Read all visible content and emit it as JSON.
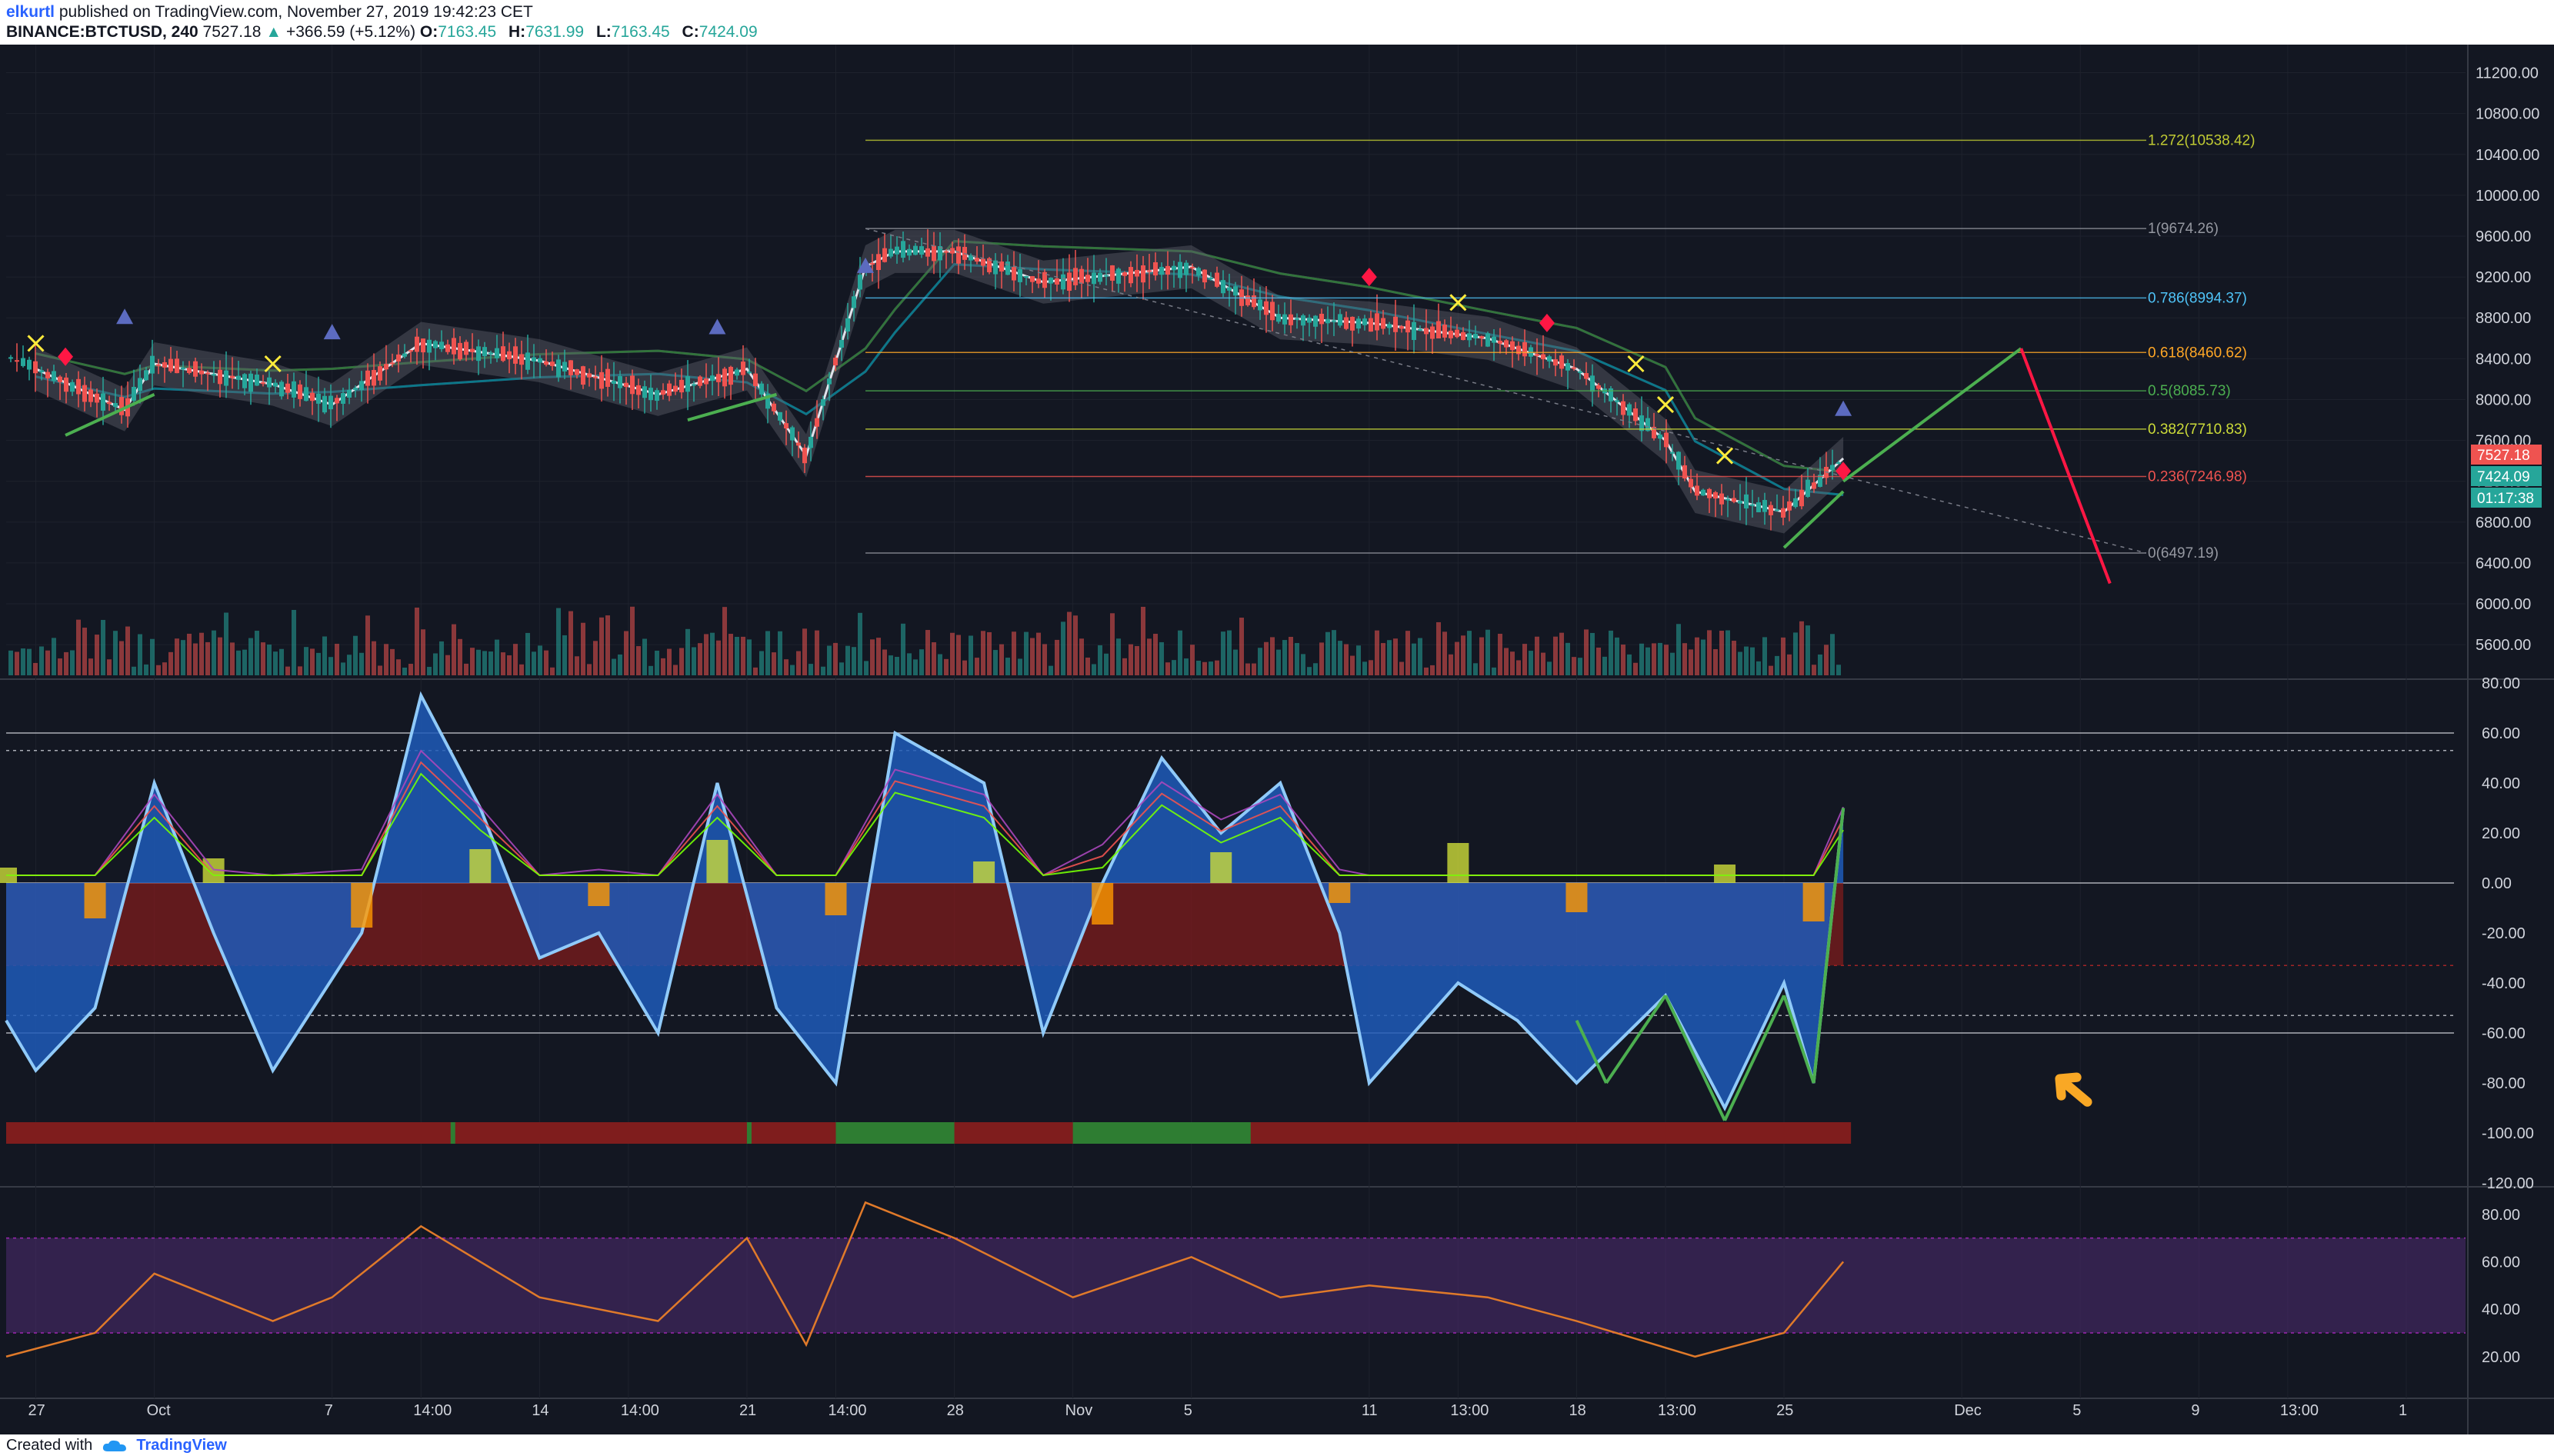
{
  "header": {
    "author": "elkurtl",
    "published_text": "published on TradingView.com, November 27, 2019 19:42:23 CET",
    "symbol": "BINANCE:BTCTUSD, 240",
    "last": "7527.18",
    "change": "+366.59 (+5.12%)",
    "o_label": "O:",
    "o_value": "7163.45",
    "h_label": "H:",
    "h_value": "7631.99",
    "l_label": "L:",
    "l_value": "7163.45",
    "c_label": "C:",
    "c_value": "7424.09"
  },
  "footer": {
    "created_with": "Created with",
    "brand": "TradingView"
  },
  "price_badges": {
    "last_price": "7527.18",
    "close_price": "7424.09",
    "countdown": "01:17:38"
  },
  "annotations": {
    "arrow": "➜"
  },
  "chart_data": [
    {
      "type": "candlestick",
      "panel": "price",
      "y_ticks": [
        "11200.00",
        "10800.00",
        "10400.00",
        "10000.00",
        "9600.00",
        "9200.00",
        "8800.00",
        "8400.00",
        "8000.00",
        "7600.00",
        "7200.00",
        "6800.00",
        "6400.00",
        "6000.00",
        "5600.00"
      ],
      "x_ticks": [
        "27",
        "Oct",
        "7",
        "14:00",
        "14",
        "14:00",
        "21",
        "14:00",
        "28",
        "Nov",
        "5",
        "11",
        "13:00",
        "18",
        "13:00",
        "25",
        "Dec",
        "5",
        "9",
        "13:00",
        "1"
      ],
      "ylim": [
        5300,
        11400
      ],
      "approx_close_path": [
        {
          "x": "Sep 27",
          "y": 8300
        },
        {
          "x": "Sep 30",
          "y": 7900
        },
        {
          "x": "Oct 1",
          "y": 8350
        },
        {
          "x": "Oct 5",
          "y": 8150
        },
        {
          "x": "Oct 7",
          "y": 7950
        },
        {
          "x": "Oct 10",
          "y": 8550
        },
        {
          "x": "Oct 14",
          "y": 8380
        },
        {
          "x": "Oct 18",
          "y": 8050
        },
        {
          "x": "Oct 21",
          "y": 8300
        },
        {
          "x": "Oct 23",
          "y": 7450
        },
        {
          "x": "Oct 25",
          "y": 9300
        },
        {
          "x": "Oct 26",
          "y": 9450
        },
        {
          "x": "Oct 28",
          "y": 9450
        },
        {
          "x": "Oct 31",
          "y": 9150
        },
        {
          "x": "Nov 5",
          "y": 9300
        },
        {
          "x": "Nov 8",
          "y": 8800
        },
        {
          "x": "Nov 11",
          "y": 8750
        },
        {
          "x": "Nov 15",
          "y": 8600
        },
        {
          "x": "Nov 18",
          "y": 8300
        },
        {
          "x": "Nov 21",
          "y": 7600
        },
        {
          "x": "Nov 22",
          "y": 7100
        },
        {
          "x": "Nov 25",
          "y": 6900
        },
        {
          "x": "Nov 27",
          "y": 7424
        }
      ],
      "fibonacci": [
        {
          "label": "1.272(10538.42)",
          "value": 10538.42,
          "color": "#c0ca33"
        },
        {
          "label": "1(9674.26)",
          "value": 9674.26,
          "color": "#9598a1"
        },
        {
          "label": "0.786(8994.37)",
          "value": 8994.37,
          "color": "#4fc3f7"
        },
        {
          "label": "0.618(8460.62)",
          "value": 8460.62,
          "color": "#ffa726"
        },
        {
          "label": "0.5(8085.73)",
          "value": 8085.73,
          "color": "#4caf50"
        },
        {
          "label": "0.382(7710.83)",
          "value": 7710.83,
          "color": "#cddc39"
        },
        {
          "label": "0.236(7246.98)",
          "value": 7246.98,
          "color": "#ef5350"
        },
        {
          "label": "0(6497.19)",
          "value": 6497.19,
          "color": "#9598a1"
        }
      ],
      "projections": [
        {
          "name": "green-projection",
          "color": "#4caf50",
          "from": {
            "x": "Nov 27",
            "y": 7200
          },
          "to": {
            "x": "Dec 3",
            "y": 8500
          }
        },
        {
          "name": "red-projection",
          "color": "#ff1744",
          "from": {
            "x": "Dec 3",
            "y": 8500
          },
          "to": {
            "x": "Dec 6",
            "y": 6200
          }
        }
      ]
    },
    {
      "type": "area",
      "panel": "wavetrend-oscillator",
      "y_ticks": [
        "80.00",
        "60.00",
        "40.00",
        "20.00",
        "0.00",
        "-20.00",
        "-40.00",
        "-60.00",
        "-80.00",
        "-100.00",
        "-120.00"
      ],
      "ylim": [
        -120,
        80
      ],
      "levels": [
        60,
        53,
        0,
        -33,
        -53,
        -60
      ],
      "approx_path": [
        {
          "x": "Sep 26",
          "y": -55
        },
        {
          "x": "Sep 27",
          "y": -75
        },
        {
          "x": "Sep 29",
          "y": -50
        },
        {
          "x": "Oct 1",
          "y": 40
        },
        {
          "x": "Oct 3",
          "y": -20
        },
        {
          "x": "Oct 5",
          "y": -75
        },
        {
          "x": "Oct 8",
          "y": -20
        },
        {
          "x": "Oct 10",
          "y": 75
        },
        {
          "x": "Oct 12",
          "y": 30
        },
        {
          "x": "Oct 14",
          "y": -30
        },
        {
          "x": "Oct 16",
          "y": -20
        },
        {
          "x": "Oct 18",
          "y": -60
        },
        {
          "x": "Oct 20",
          "y": 40
        },
        {
          "x": "Oct 22",
          "y": -50
        },
        {
          "x": "Oct 24",
          "y": -80
        },
        {
          "x": "Oct 26",
          "y": 60
        },
        {
          "x": "Oct 29",
          "y": 40
        },
        {
          "x": "Oct 31",
          "y": -60
        },
        {
          "x": "Nov 2",
          "y": 0
        },
        {
          "x": "Nov 4",
          "y": 50
        },
        {
          "x": "Nov 6",
          "y": 20
        },
        {
          "x": "Nov 8",
          "y": 40
        },
        {
          "x": "Nov 10",
          "y": -20
        },
        {
          "x": "Nov 11",
          "y": -80
        },
        {
          "x": "Nov 14",
          "y": -40
        },
        {
          "x": "Nov 16",
          "y": -55
        },
        {
          "x": "Nov 18",
          "y": -80
        },
        {
          "x": "Nov 21",
          "y": -45
        },
        {
          "x": "Nov 23",
          "y": -90
        },
        {
          "x": "Nov 25",
          "y": -40
        },
        {
          "x": "Nov 26",
          "y": -80
        },
        {
          "x": "Nov 27",
          "y": 30
        }
      ]
    },
    {
      "type": "line",
      "panel": "rsi",
      "y_ticks": [
        "80.00",
        "60.00",
        "40.00",
        "20.00"
      ],
      "ylim": [
        5,
        90
      ],
      "band": [
        30,
        70
      ],
      "approx_path": [
        {
          "x": "Sep 26",
          "y": 20
        },
        {
          "x": "Sep 29",
          "y": 30
        },
        {
          "x": "Oct 1",
          "y": 55
        },
        {
          "x": "Oct 5",
          "y": 35
        },
        {
          "x": "Oct 7",
          "y": 45
        },
        {
          "x": "Oct 10",
          "y": 75
        },
        {
          "x": "Oct 14",
          "y": 45
        },
        {
          "x": "Oct 18",
          "y": 35
        },
        {
          "x": "Oct 21",
          "y": 70
        },
        {
          "x": "Oct 23",
          "y": 25
        },
        {
          "x": "Oct 25",
          "y": 85
        },
        {
          "x": "Oct 28",
          "y": 70
        },
        {
          "x": "Nov 1",
          "y": 45
        },
        {
          "x": "Nov 5",
          "y": 62
        },
        {
          "x": "Nov 8",
          "y": 45
        },
        {
          "x": "Nov 11",
          "y": 50
        },
        {
          "x": "Nov 15",
          "y": 45
        },
        {
          "x": "Nov 18",
          "y": 35
        },
        {
          "x": "Nov 22",
          "y": 20
        },
        {
          "x": "Nov 25",
          "y": 30
        },
        {
          "x": "Nov 27",
          "y": 60
        }
      ]
    }
  ]
}
